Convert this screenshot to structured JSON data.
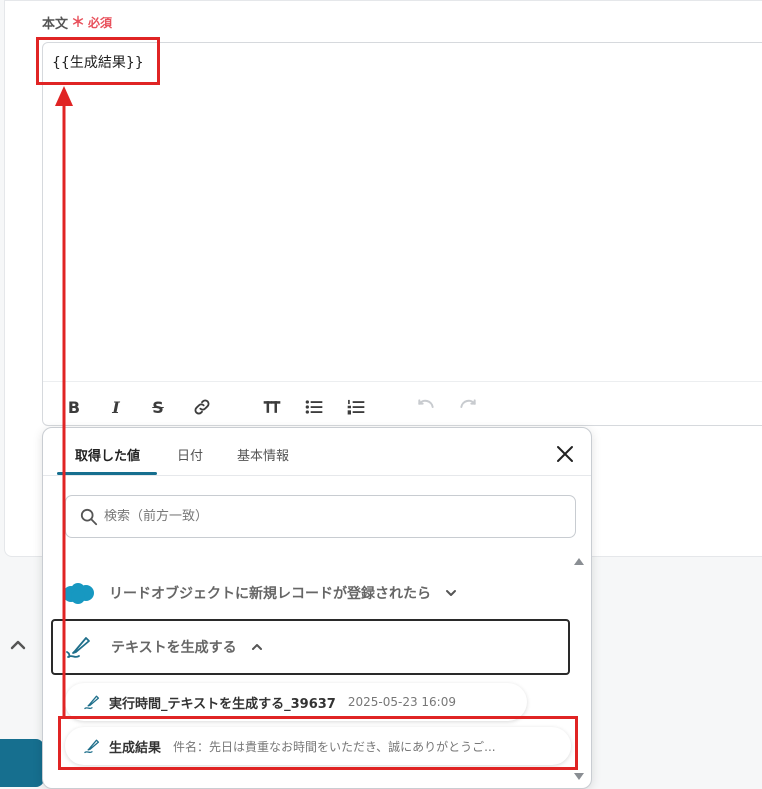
{
  "field": {
    "label": "本文",
    "required_mark": "＊",
    "required_text": "必須",
    "value": "{{生成結果}}"
  },
  "toolbar": {
    "bold": "B",
    "italic": "I",
    "strike": "S"
  },
  "panel": {
    "tabs": [
      {
        "label": "取得した値",
        "active": true
      },
      {
        "label": "日付",
        "active": false
      },
      {
        "label": "基本情報",
        "active": false
      }
    ],
    "search_placeholder": "検索（前方一致）",
    "groups": [
      {
        "label": "リードオブジェクトに新規レコードが登録されたら",
        "expanded": false
      },
      {
        "label": "テキストを生成する",
        "expanded": true
      }
    ],
    "items": [
      {
        "name": "実行時間_テキストを生成する_39637",
        "meta": "2025-05-23 16:09"
      },
      {
        "name": "生成結果",
        "meta": "件名：先日は貴重なお時間をいただき、誠にありがとうご..."
      }
    ]
  },
  "colors": {
    "accent": "#166f8f",
    "highlight": "#e02424",
    "required": "#e8505b",
    "salesforce": "#1798c1"
  }
}
